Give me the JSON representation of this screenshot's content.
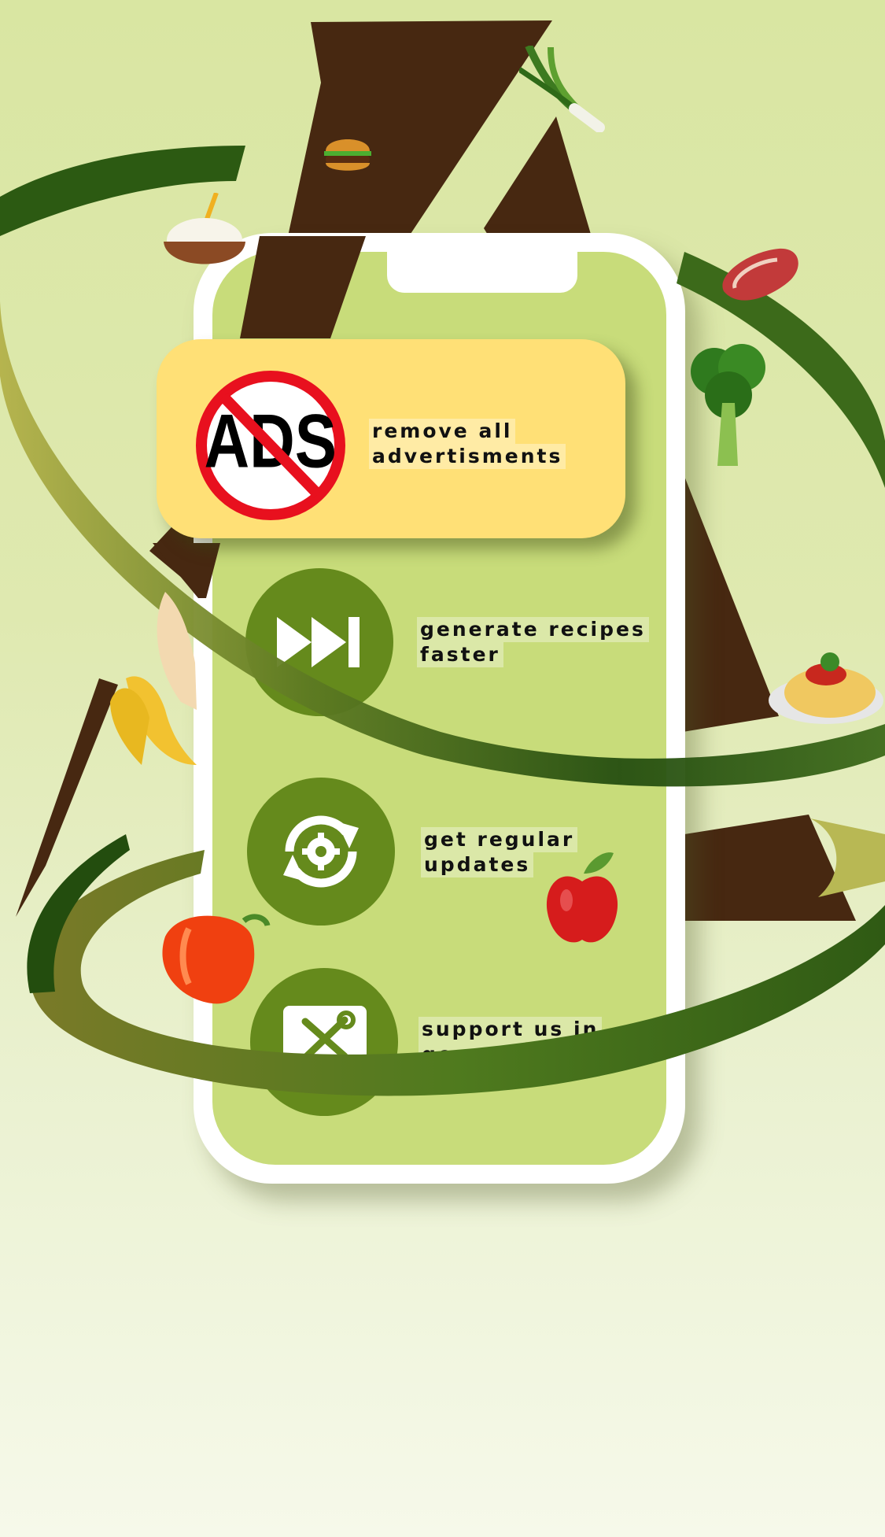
{
  "colors": {
    "accent_green": "#658a1c",
    "screen_green": "#c8dc7a",
    "card_yellow": "#ffe076",
    "brown": "#472811"
  },
  "ads_badge": {
    "label": "ADS"
  },
  "features": [
    {
      "line1": "remove all",
      "line2": "advertisments",
      "icon": "no-ads-icon"
    },
    {
      "line1": "generate recipes",
      "line2": "faster",
      "icon": "fast-forward-icon"
    },
    {
      "line1": "get regular",
      "line2": "updates",
      "icon": "refresh-gear-icon"
    },
    {
      "line1": "support us in",
      "line2": "general",
      "icon": "tools-support-icon"
    }
  ]
}
